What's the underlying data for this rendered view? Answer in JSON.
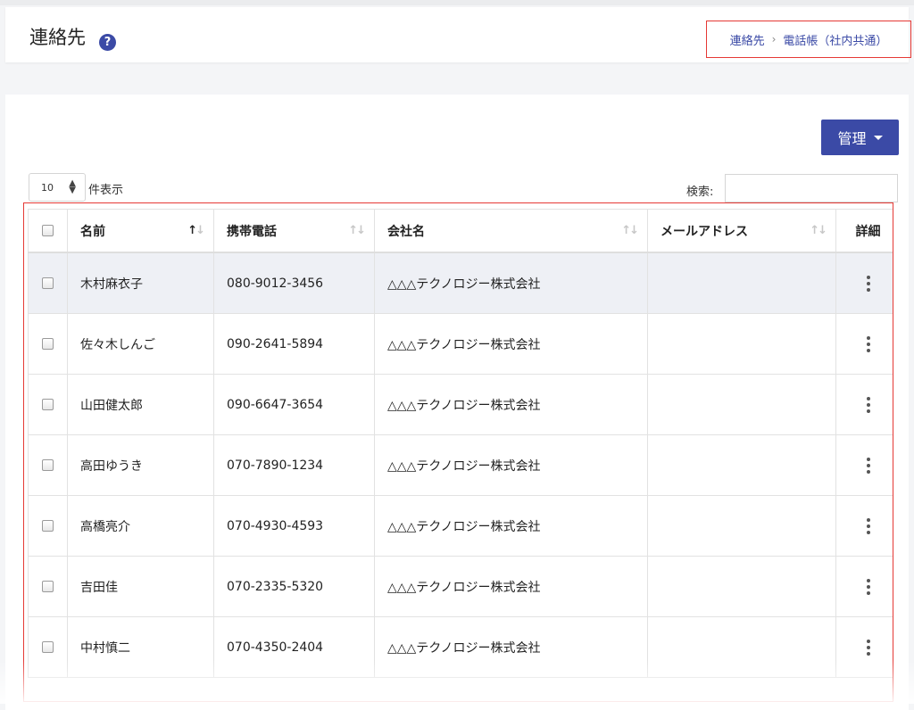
{
  "header": {
    "title": "連絡先",
    "help_icon": "?",
    "breadcrumb": [
      "連絡先",
      "電話帳（社内共通）"
    ]
  },
  "toolbar": {
    "manage_label": "管理"
  },
  "table_controls": {
    "page_length": "10",
    "length_label": "件表示",
    "search_label": "検索:"
  },
  "table": {
    "columns": [
      "名前",
      "携帯電話",
      "会社名",
      "メールアドレス",
      "詳細"
    ],
    "rows": [
      {
        "name": "木村麻衣子",
        "phone": "080-9012-3456",
        "company": "△△△テクノロジー株式会社",
        "email": ""
      },
      {
        "name": "佐々木しんご",
        "phone": "090-2641-5894",
        "company": "△△△テクノロジー株式会社",
        "email": ""
      },
      {
        "name": "山田健太郎",
        "phone": "090-6647-3654",
        "company": "△△△テクノロジー株式会社",
        "email": ""
      },
      {
        "name": "高田ゆうき",
        "phone": "070-7890-1234",
        "company": "△△△テクノロジー株式会社",
        "email": ""
      },
      {
        "name": "高橋亮介",
        "phone": "070-4930-4593",
        "company": "△△△テクノロジー株式会社",
        "email": ""
      },
      {
        "name": "吉田佳",
        "phone": "070-2335-5320",
        "company": "△△△テクノロジー株式会社",
        "email": ""
      },
      {
        "name": "中村慎二",
        "phone": "070-4350-2404",
        "company": "△△△テクノロジー株式会社",
        "email": ""
      }
    ]
  },
  "colors": {
    "accent": "#3b4aa6",
    "highlight_border": "#e53935",
    "row_shade": "#eef0f5"
  }
}
